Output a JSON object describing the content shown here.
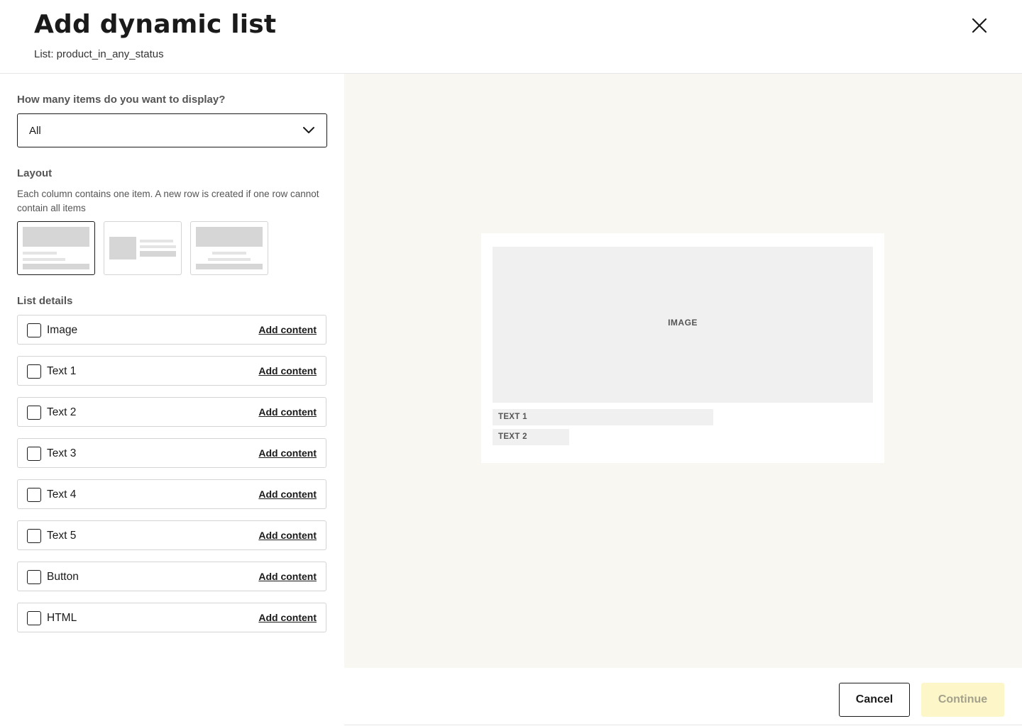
{
  "header": {
    "title": "Add dynamic list",
    "subtitle": "List: product_in_any_status"
  },
  "display": {
    "label": "How many items do you want to display?",
    "selected": "All"
  },
  "layout": {
    "label": "Layout",
    "description": "Each column contains one item. A new row is created if one row cannot contain all items",
    "options": [
      "image-top-text-left",
      "image-left-text-right",
      "image-top-text-center"
    ],
    "selected_index": 0
  },
  "list_details": {
    "label": "List details",
    "action_label": "Add content",
    "items": [
      {
        "label": "Image",
        "checked": false
      },
      {
        "label": "Text 1",
        "checked": false
      },
      {
        "label": "Text 2",
        "checked": false
      },
      {
        "label": "Text 3",
        "checked": false
      },
      {
        "label": "Text 4",
        "checked": false
      },
      {
        "label": "Text 5",
        "checked": false
      },
      {
        "label": "Button",
        "checked": false
      },
      {
        "label": "HTML",
        "checked": false
      }
    ]
  },
  "preview": {
    "image_label": "IMAGE",
    "text1_label": "TEXT 1",
    "text2_label": "TEXT 2",
    "background": "#f9f7f2"
  },
  "footer": {
    "cancel_label": "Cancel",
    "continue_label": "Continue",
    "continue_disabled": true,
    "continue_color": "#fcf6c8"
  },
  "icons": {
    "close": "close-icon",
    "dropdown": "chevron-down-icon"
  }
}
